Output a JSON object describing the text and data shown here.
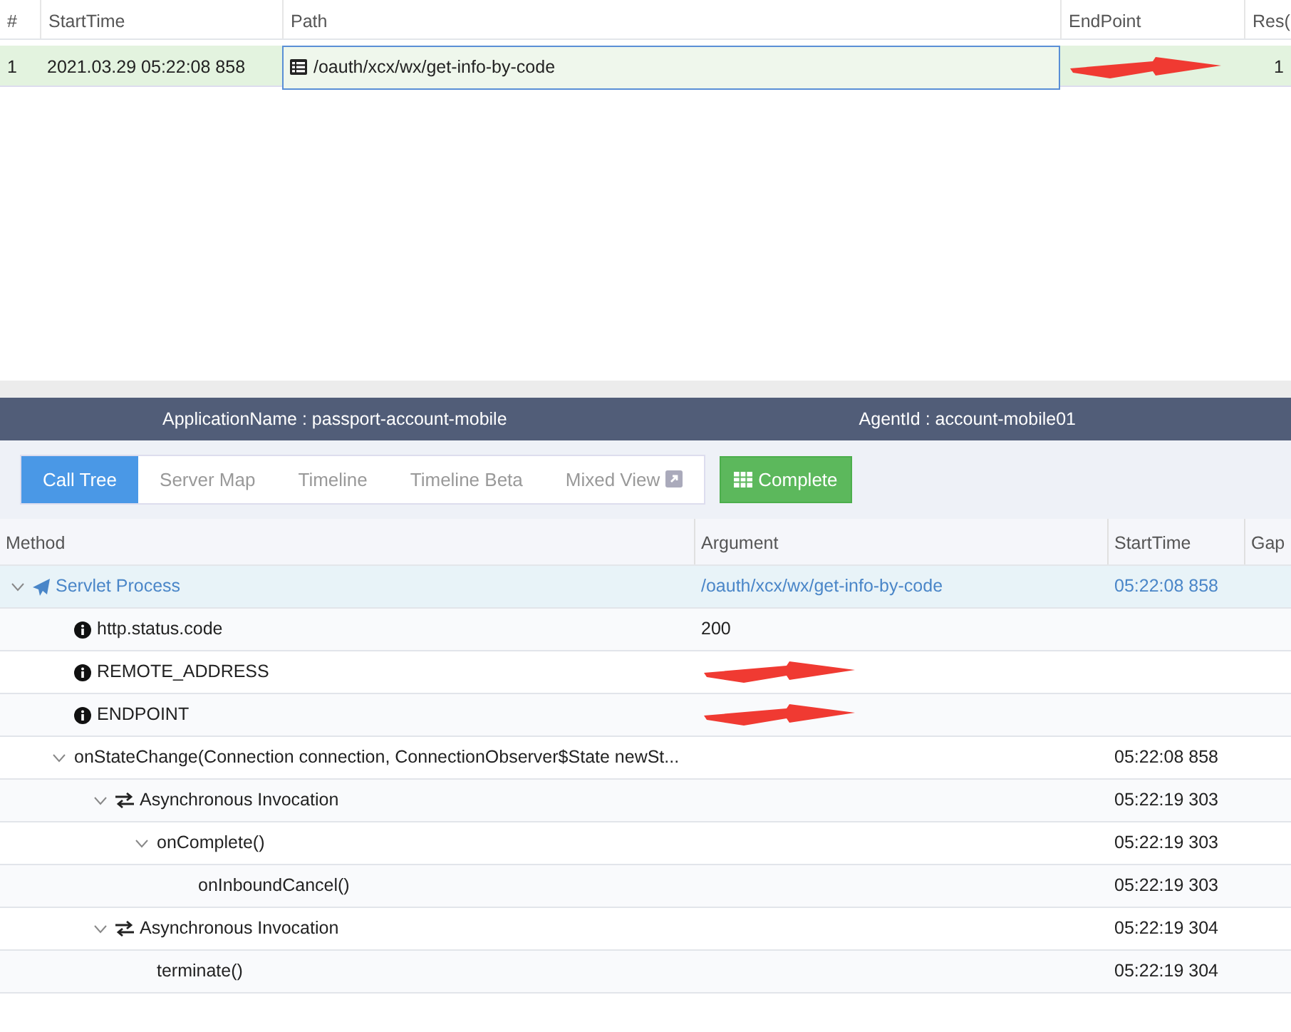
{
  "list_table": {
    "columns": [
      "#",
      "StartTime",
      "Path",
      "EndPoint",
      "Res("
    ],
    "rows": [
      {
        "index": "1",
        "start_time": "2021.03.29 05:22:08 858",
        "path": "/oauth/xcx/wx/get-info-by-code",
        "res": "1",
        "selected": true,
        "endpoint_redacted": true
      }
    ]
  },
  "info_bar": {
    "application": "ApplicationName : passport-account-mobile",
    "agent": "AgentId : account-mobile01"
  },
  "tabs": [
    {
      "label": "Call Tree",
      "selected": true,
      "external": false
    },
    {
      "label": "Server Map",
      "selected": false,
      "external": false
    },
    {
      "label": "Timeline",
      "selected": false,
      "external": false
    },
    {
      "label": "Timeline Beta",
      "selected": false,
      "external": false
    },
    {
      "label": "Mixed View",
      "selected": false,
      "external": true
    }
  ],
  "complete_button": "Complete",
  "call_tree": {
    "columns": [
      "Method",
      "Argument",
      "StartTime",
      "Gap"
    ],
    "rows": [
      {
        "kind": "servlet",
        "method": "Servlet Process",
        "argument": "/oauth/xcx/wx/get-info-by-code",
        "start_time": "05:22:08 858",
        "expanded": true,
        "children": [
          {
            "kind": "info",
            "method": "http.status.code",
            "argument": "200"
          },
          {
            "kind": "info",
            "method": "REMOTE_ADDRESS",
            "argument_redacted": true
          },
          {
            "kind": "info",
            "method": "ENDPOINT",
            "argument_redacted": true
          },
          {
            "kind": "method",
            "method": "onStateChange(Connection connection, ConnectionObserver$State newSt...",
            "start_time": "05:22:08 858",
            "expanded": true,
            "children": [
              {
                "kind": "async",
                "method": "Asynchronous Invocation",
                "start_time": "05:22:19 303",
                "expanded": true,
                "children": [
                  {
                    "kind": "method",
                    "method": "onComplete()",
                    "start_time": "05:22:19 303",
                    "expanded": true,
                    "children": [
                      {
                        "kind": "method",
                        "method": "onInboundCancel()",
                        "start_time": "05:22:19 303"
                      }
                    ]
                  }
                ]
              },
              {
                "kind": "async",
                "method": "Asynchronous Invocation",
                "start_time": "05:22:19 304",
                "expanded": true,
                "children": [
                  {
                    "kind": "method",
                    "method": "terminate()",
                    "start_time": "05:22:19 304"
                  }
                ]
              }
            ]
          }
        ]
      }
    ]
  }
}
